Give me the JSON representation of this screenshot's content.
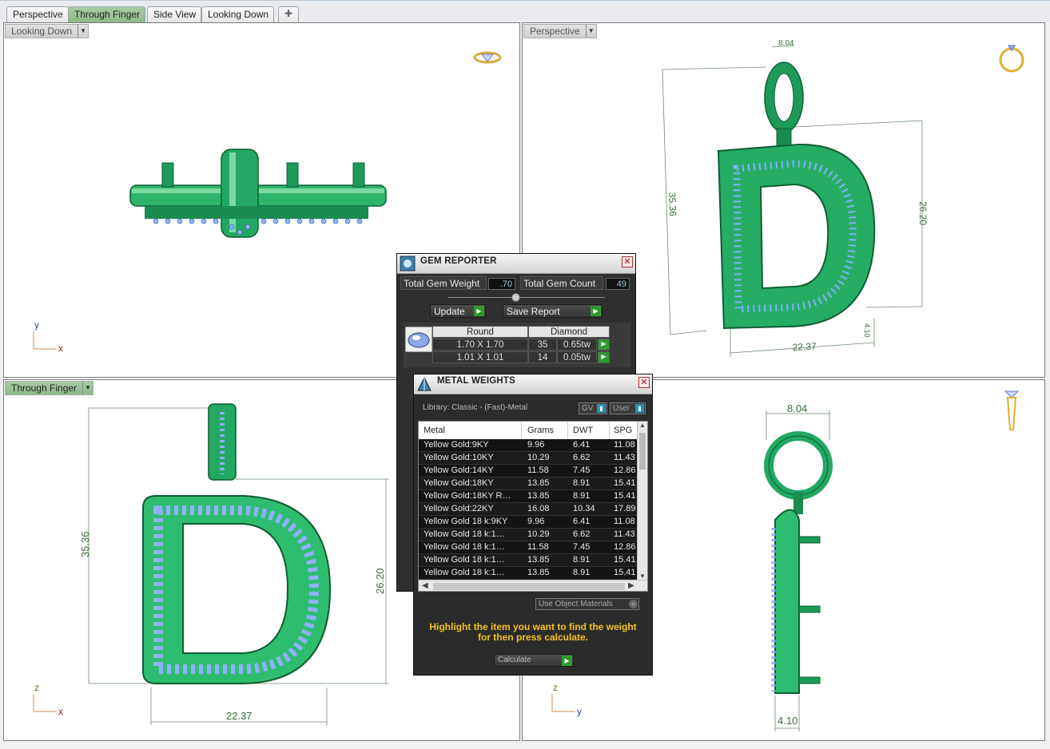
{
  "tabs": [
    {
      "label": "Perspective",
      "active": false
    },
    {
      "label": "Through Finger",
      "active": true
    },
    {
      "label": "Side View",
      "active": false
    },
    {
      "label": "Looking Down",
      "active": false
    }
  ],
  "viewports": {
    "top_left": {
      "label": "Looking Down",
      "axis_x": "x",
      "axis_y": "y"
    },
    "top_right": {
      "label": "Perspective",
      "dims": {
        "bail": "8.04",
        "height": "35.36",
        "inner_height": "26.20",
        "width": "22.37",
        "depth": "4.10"
      }
    },
    "bottom_left": {
      "label": "Through Finger",
      "axis_x": "x",
      "axis_z": "z",
      "dims": {
        "height": "35.36",
        "inner_height": "26.20",
        "width": "22.37"
      }
    },
    "bottom_right": {
      "label": "",
      "axis_y": "y",
      "axis_z": "z",
      "dims": {
        "bail": "8.04",
        "depth": "4.10"
      }
    }
  },
  "gem_reporter": {
    "title": "GEM REPORTER",
    "total_weight_label": "Total Gem Weight",
    "total_weight_value": ".70",
    "total_count_label": "Total Gem Count",
    "total_count_value": "49",
    "update_label": "Update",
    "save_label": "Save Report",
    "headers": [
      "Round",
      "Diamond"
    ],
    "rows": [
      {
        "size": "1.70 X 1.70",
        "count": "35",
        "weight": "0.65tw"
      },
      {
        "size": "1.01 X 1.01",
        "count": "14",
        "weight": "0.05tw"
      }
    ]
  },
  "metal_weights": {
    "title": "METAL WEIGHTS",
    "library": "Library: Classic - (Fast)-Metal",
    "gv_label": "GV",
    "user_label": "User",
    "columns": [
      "Metal",
      "Grams",
      "DWT",
      "SPG"
    ],
    "rows": [
      [
        "Yellow Gold:9KY",
        "9.96",
        "6.41",
        "11.08"
      ],
      [
        "Yellow Gold:10KY",
        "10.29",
        "6.62",
        "11.43"
      ],
      [
        "Yellow Gold:14KY",
        "11.58",
        "7.45",
        "12.86"
      ],
      [
        "Yellow Gold:18KY",
        "13.85",
        "8.91",
        "15.41"
      ],
      [
        "Yellow Gold:18KY R…",
        "13.85",
        "8.91",
        "15.41"
      ],
      [
        "Yellow Gold:22KY",
        "16.08",
        "10.34",
        "17.89"
      ],
      [
        "Yellow Gold 18 k:9KY",
        "9.96",
        "6.41",
        "11.08"
      ],
      [
        "Yellow Gold 18 k:1…",
        "10.29",
        "6.62",
        "11.43"
      ],
      [
        "Yellow Gold 18 k:1…",
        "11.58",
        "7.45",
        "12.86"
      ],
      [
        "Yellow Gold 18 k:1…",
        "13.85",
        "8.91",
        "15.41"
      ],
      [
        "Yellow Gold 18 k:1…",
        "13.85",
        "8.91",
        "15.41"
      ]
    ],
    "use_object_materials": "Use Object Materials",
    "hint_line1": "Highlight the item you want to find the weight",
    "hint_line2": "for then press calculate.",
    "calculate_label": "Calculate"
  }
}
